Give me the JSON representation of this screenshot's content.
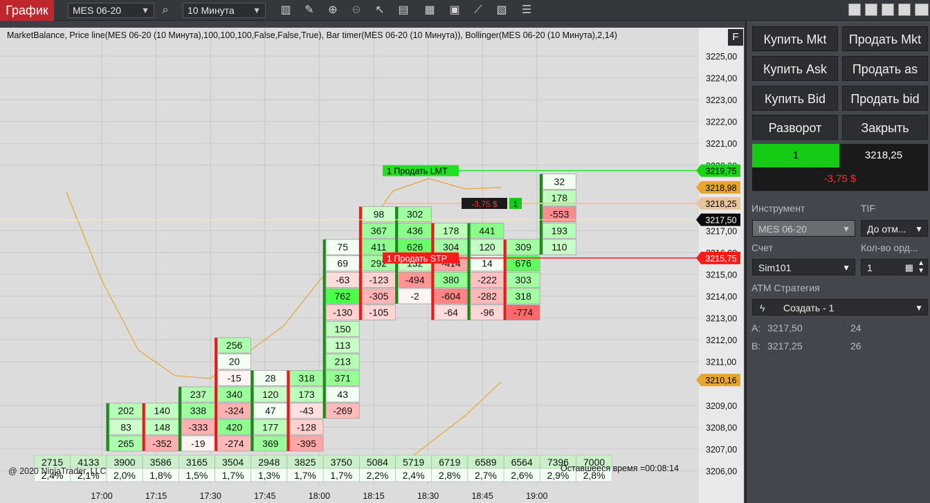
{
  "toolbar": {
    "title": "График",
    "instrument": "MES 06-20",
    "interval": "10 Минута"
  },
  "chart": {
    "indicator_label": "MarketBalance, Price line(MES 06-20 (10 Минута),100,100,100,False,False,True), Bar timer(MES 06-20 (10 Минута)), Bollinger(MES 06-20 (10 Минута),2,14)",
    "f_button": "F",
    "copyright": "@ 2020 NinjaTrader, LLC",
    "remaining_time": "Оставшееся время =00:08:14",
    "price_labels": [
      "3225,00",
      "3224,00",
      "3223,00",
      "3222,00",
      "3221,00",
      "3220,00",
      "3217,00",
      "3216,00",
      "3215,00",
      "3214,00",
      "3213,00",
      "3212,00",
      "3211,00",
      "3209,00",
      "3208,00",
      "3207,00",
      "3206,00"
    ],
    "price_values": [
      3225,
      3224,
      3223,
      3222,
      3221,
      3220,
      3217,
      3216,
      3215,
      3214,
      3213,
      3212,
      3211,
      3209,
      3208,
      3207,
      3206
    ],
    "time_labels": [
      "17:00",
      "17:15",
      "17:30",
      "17:45",
      "18:00",
      "18:15",
      "18:30",
      "18:45",
      "19:00"
    ],
    "markers": [
      {
        "price": 3219.75,
        "label": "3219,75",
        "color": "#18d418",
        "text": "#000"
      },
      {
        "price": 3218.98,
        "label": "3218,98",
        "color": "#e6a52c",
        "text": "#000"
      },
      {
        "price": 3218.25,
        "label": "3218,25",
        "color": "#e8c49a",
        "text": "#000"
      },
      {
        "price": 3217.5,
        "label": "3217,50",
        "color": "#0a0a0a",
        "text": "#fff"
      },
      {
        "price": 3215.75,
        "label": "3215,75",
        "color": "#ff1a1a",
        "text": "#fff"
      },
      {
        "price": 3210.16,
        "label": "3210,16",
        "color": "#e6a52c",
        "text": "#000"
      }
    ],
    "orders": [
      {
        "price": 3219.75,
        "text": "1  Продать LMT",
        "color": "#22e022",
        "text_color": "#000"
      },
      {
        "price": 3215.75,
        "text": "1  Продать STP",
        "color": "#ff1a1a",
        "text_color": "#fff"
      }
    ],
    "position_pnl": "-3,75 $",
    "position_qty": "1",
    "volume_row": [
      "2715",
      "4133",
      "3900",
      "3586",
      "3165",
      "3504",
      "2948",
      "3825",
      "3750",
      "5084",
      "5719",
      "6719",
      "6589",
      "6564",
      "7396",
      "7000"
    ],
    "percent_row": [
      "2,4%",
      "2,1%",
      "2,0%",
      "1,8%",
      "1,5%",
      "1,7%",
      "1,3%",
      "1,7%",
      "1,7%",
      "2,2%",
      "2,4%",
      "2,8%",
      "2,7%",
      "2,6%",
      "2,9%",
      "2,8%"
    ],
    "bars": [
      {
        "cells": [
          {
            "p": 3207.25,
            "v": "265"
          },
          {
            "p": 3208.0,
            "v": "83"
          },
          {
            "p": 3208.75,
            "v": "202"
          }
        ]
      },
      {
        "cells": [
          {
            "p": 3207.25,
            "v": "-352"
          },
          {
            "p": 3208.0,
            "v": "148"
          },
          {
            "p": 3208.75,
            "v": "140"
          }
        ]
      },
      {
        "cells": [
          {
            "p": 3207.25,
            "v": "-19"
          },
          {
            "p": 3208.0,
            "v": "-333"
          },
          {
            "p": 3208.75,
            "v": "338"
          },
          {
            "p": 3209.5,
            "v": "237"
          }
        ]
      },
      {
        "cells": [
          {
            "p": 3207.25,
            "v": "-274"
          },
          {
            "p": 3208.0,
            "v": "420"
          },
          {
            "p": 3208.75,
            "v": "-324"
          },
          {
            "p": 3209.5,
            "v": "340"
          },
          {
            "p": 3210.25,
            "v": "-15"
          },
          {
            "p": 3211.0,
            "v": "20"
          },
          {
            "p": 3211.75,
            "v": "256"
          }
        ]
      },
      {
        "cells": [
          {
            "p": 3207.25,
            "v": "369"
          },
          {
            "p": 3208.0,
            "v": "177"
          },
          {
            "p": 3208.75,
            "v": "47"
          },
          {
            "p": 3209.5,
            "v": "120"
          },
          {
            "p": 3210.25,
            "v": "28"
          }
        ]
      },
      {
        "cells": [
          {
            "p": 3207.25,
            "v": "-395"
          },
          {
            "p": 3208.0,
            "v": "-128"
          },
          {
            "p": 3208.75,
            "v": "-43"
          },
          {
            "p": 3209.5,
            "v": "173"
          },
          {
            "p": 3210.25,
            "v": "318"
          }
        ]
      },
      {
        "cells": [
          {
            "p": 3208.75,
            "v": "-269"
          },
          {
            "p": 3209.5,
            "v": "43"
          },
          {
            "p": 3210.25,
            "v": "371"
          },
          {
            "p": 3211.0,
            "v": "213"
          },
          {
            "p": 3211.75,
            "v": "113"
          },
          {
            "p": 3212.5,
            "v": "150"
          },
          {
            "p": 3213.25,
            "v": "-130"
          },
          {
            "p": 3214.0,
            "v": "762"
          },
          {
            "p": 3214.75,
            "v": "-63"
          },
          {
            "p": 3215.5,
            "v": "69"
          },
          {
            "p": 3216.25,
            "v": "75"
          }
        ]
      },
      {
        "cells": [
          {
            "p": 3213.25,
            "v": "-105"
          },
          {
            "p": 3214.0,
            "v": "-305"
          },
          {
            "p": 3214.75,
            "v": "-123"
          },
          {
            "p": 3215.5,
            "v": "292"
          },
          {
            "p": 3216.25,
            "v": "411"
          },
          {
            "p": 3217.0,
            "v": "367"
          },
          {
            "p": 3217.75,
            "v": "98"
          }
        ]
      },
      {
        "cells": [
          {
            "p": 3214.0,
            "v": "-2"
          },
          {
            "p": 3214.75,
            "v": "-494"
          },
          {
            "p": 3215.5,
            "v": "132"
          },
          {
            "p": 3216.25,
            "v": "626"
          },
          {
            "p": 3217.0,
            "v": "436"
          },
          {
            "p": 3217.75,
            "v": "302"
          }
        ]
      },
      {
        "cells": [
          {
            "p": 3213.25,
            "v": "-64"
          },
          {
            "p": 3214.0,
            "v": "-604"
          },
          {
            "p": 3214.75,
            "v": "380"
          },
          {
            "p": 3215.5,
            "v": "-414"
          },
          {
            "p": 3216.25,
            "v": "304"
          },
          {
            "p": 3217.0,
            "v": "178"
          }
        ]
      },
      {
        "cells": [
          {
            "p": 3213.25,
            "v": "-96"
          },
          {
            "p": 3214.0,
            "v": "-282"
          },
          {
            "p": 3214.75,
            "v": "-222"
          },
          {
            "p": 3215.5,
            "v": "14"
          },
          {
            "p": 3216.25,
            "v": "120"
          },
          {
            "p": 3217.0,
            "v": "441"
          }
        ]
      },
      {
        "cells": [
          {
            "p": 3213.25,
            "v": "-774"
          },
          {
            "p": 3214.0,
            "v": "318"
          },
          {
            "p": 3214.75,
            "v": "303"
          },
          {
            "p": 3215.5,
            "v": "676"
          },
          {
            "p": 3216.25,
            "v": "309"
          }
        ]
      },
      {
        "cells": [
          {
            "p": 3216.25,
            "v": "110"
          },
          {
            "p": 3217.0,
            "v": "193"
          },
          {
            "p": 3217.75,
            "v": "-553"
          },
          {
            "p": 3218.5,
            "v": "178"
          },
          {
            "p": 3219.25,
            "v": "32"
          }
        ]
      }
    ]
  },
  "panel": {
    "buy_market": "Купить Mkt",
    "sell_market": "Продать Mkt",
    "buy_ask": "Купить Ask",
    "sell_ask": "Продать as",
    "buy_bid": "Купить Bid",
    "sell_bid": "Продать bid",
    "reverse": "Разворот",
    "close": "Закрыть",
    "position_qty": "1",
    "position_price": "3218,25",
    "pnl": "-3,75 $",
    "instrument_label": "Инструмент",
    "instrument_value": "MES 06-20",
    "tif_label": "TIF",
    "tif_value": "До отм...",
    "account_label": "Счет",
    "account_value": "Sim101",
    "qty_label": "Кол-во орд...",
    "qty_value": "1",
    "atm_label": "ATM Стратегия",
    "atm_value": "Создать - 1",
    "ask_label": "A:",
    "ask_price": "3217,50",
    "ask_size": "24",
    "bid_label": "B:",
    "bid_price": "3217,25",
    "bid_size": "26"
  }
}
